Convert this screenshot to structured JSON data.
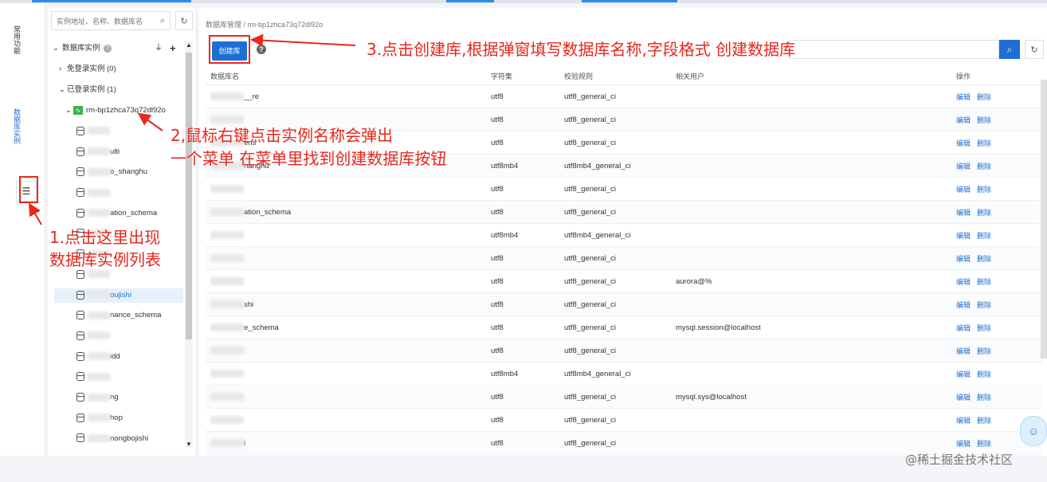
{
  "rail": {
    "tabs": [
      "常用功能",
      "数据库实例"
    ]
  },
  "tree": {
    "search_placeholder": "实例地址、名称、数据库名",
    "header": "数据库实例",
    "groups": [
      {
        "label": "免登录实例 (0)",
        "arrow": "›"
      },
      {
        "label": "已登录实例 (1)",
        "arrow": "⌄"
      }
    ],
    "instance": "rm-bp1zhca73q72dl92o",
    "dbs": [
      {
        "text": ""
      },
      {
        "text": "ulti"
      },
      {
        "text": "o_shanghu"
      },
      {
        "text": ""
      },
      {
        "text": "ation_schema"
      },
      {
        "text": ""
      },
      {
        "text": ""
      },
      {
        "text": ""
      },
      {
        "text": "oujishi",
        "selected": true
      },
      {
        "text": "nance_schema"
      },
      {
        "text": ""
      },
      {
        "text": "idd"
      },
      {
        "text": ""
      },
      {
        "text": "ng"
      },
      {
        "text": "hop"
      },
      {
        "text": "nongbojishi"
      }
    ]
  },
  "main": {
    "breadcrumb": "数据库管理 / rm-bp1zhca73q72dl92o",
    "create_label": "创建库",
    "columns": [
      "数据库名",
      "字符集",
      "校验规则",
      "相关用户",
      "操作"
    ],
    "actions": {
      "edit": "编辑",
      "delete": "删除"
    },
    "rows": [
      {
        "name": "__re",
        "charset": "utf8",
        "collation": "utf8_general_ci",
        "user": ""
      },
      {
        "name": "",
        "charset": "utf8",
        "collation": "utf8_general_ci",
        "user": ""
      },
      {
        "name": "ens",
        "charset": "utf8",
        "collation": "utf8_general_ci",
        "user": ""
      },
      {
        "name": "hanghu",
        "charset": "utf8mb4",
        "collation": "utf8mb4_general_ci",
        "user": ""
      },
      {
        "name": "",
        "charset": "utf8",
        "collation": "utf8_general_ci",
        "user": ""
      },
      {
        "name": "ation_schema",
        "charset": "utf8",
        "collation": "utf8_general_ci",
        "user": ""
      },
      {
        "name": "",
        "charset": "utf8mb4",
        "collation": "utf8mb4_general_ci",
        "user": ""
      },
      {
        "name": "",
        "charset": "utf8",
        "collation": "utf8_general_ci",
        "user": ""
      },
      {
        "name": "",
        "charset": "utf8",
        "collation": "utf8_general_ci",
        "user": "aurora@%"
      },
      {
        "name": "shi",
        "charset": "utf8",
        "collation": "utf8_general_ci",
        "user": ""
      },
      {
        "name": "e_schema",
        "charset": "utf8",
        "collation": "utf8_general_ci",
        "user": "mysql.session@localhost"
      },
      {
        "name": "",
        "charset": "utf8",
        "collation": "utf8_general_ci",
        "user": ""
      },
      {
        "name": "",
        "charset": "utf8mb4",
        "collation": "utf8mb4_general_ci",
        "user": ""
      },
      {
        "name": "",
        "charset": "utf8",
        "collation": "utf8_general_ci",
        "user": "mysql.sys@localhost"
      },
      {
        "name": "",
        "charset": "utf8",
        "collation": "utf8_general_ci",
        "user": ""
      },
      {
        "name": "i",
        "charset": "utf8",
        "collation": "utf8_general_ci",
        "user": ""
      }
    ]
  },
  "annotations": {
    "step1": [
      "1.点击这里出现",
      "数据库实例列表"
    ],
    "step2": [
      "2,鼠标右键点击实例名称会弹出",
      "一个菜单 在菜单里找到创建数据库按钮"
    ],
    "step3": "3.点击创建库,根据弹窗填写数据库名称,字段格式 创建数据库"
  },
  "watermark": "@稀土掘金技术社区",
  "colors": {
    "accent": "#1d6fd6",
    "annotation": "#e8271d"
  }
}
